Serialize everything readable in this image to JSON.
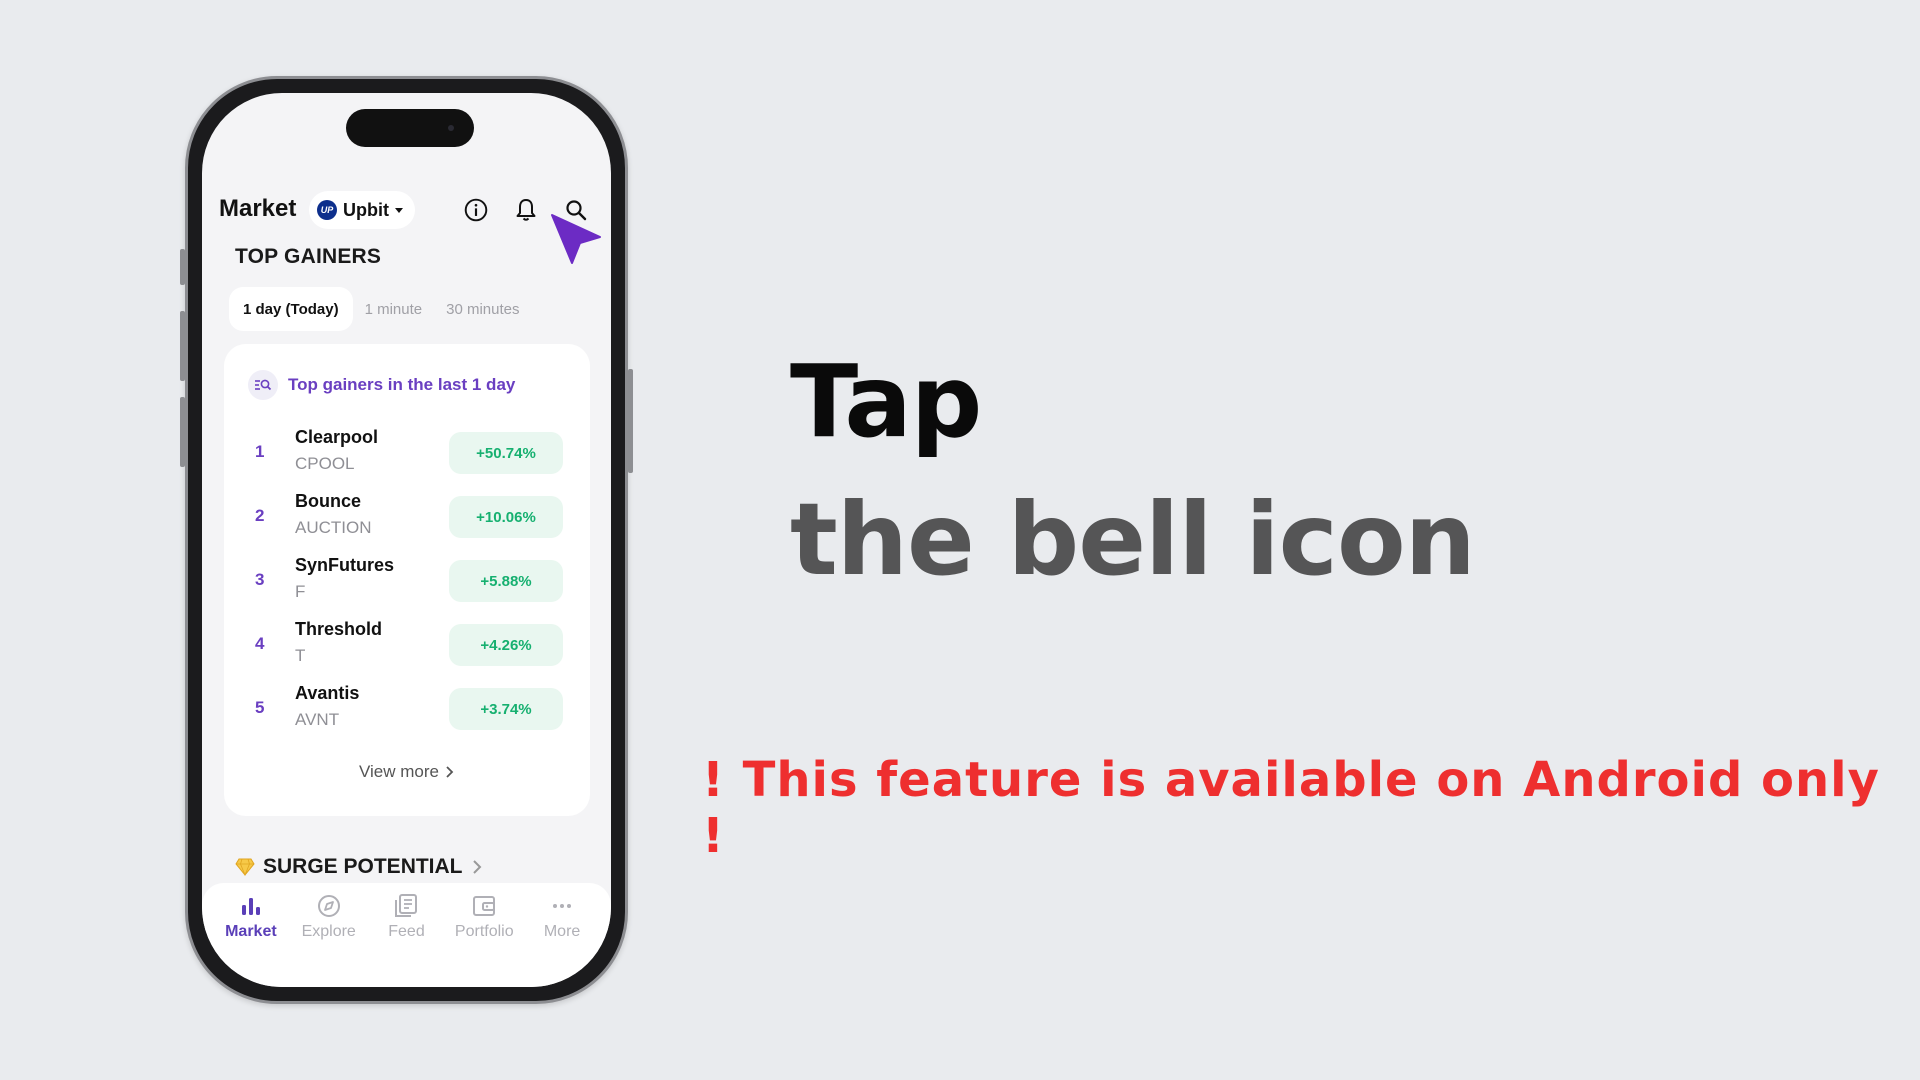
{
  "header": {
    "title": "Market",
    "exchange": {
      "name": "Upbit",
      "logo_text": "UP"
    }
  },
  "section": {
    "title": "TOP GAINERS",
    "tabs": [
      "1 day (Today)",
      "1 minute",
      "30 minutes"
    ],
    "active_tab": "1 day (Today)"
  },
  "card": {
    "heading": "Top gainers in the last 1 day",
    "rows": [
      {
        "rank": "1",
        "name": "Clearpool",
        "symbol": "CPOOL",
        "change": "+50.74%"
      },
      {
        "rank": "2",
        "name": "Bounce",
        "symbol": "AUCTION",
        "change": "+10.06%"
      },
      {
        "rank": "3",
        "name": "SynFutures",
        "symbol": "F",
        "change": "+5.88%"
      },
      {
        "rank": "4",
        "name": "Threshold",
        "symbol": "T",
        "change": "+4.26%"
      },
      {
        "rank": "5",
        "name": "Avantis",
        "symbol": "AVNT",
        "change": "+3.74%"
      }
    ],
    "view_more": "View more"
  },
  "surge": {
    "title": "SURGE POTENTIAL"
  },
  "nav": {
    "items": [
      {
        "label": "Market",
        "icon": "bar-chart-icon"
      },
      {
        "label": "Explore",
        "icon": "compass-icon"
      },
      {
        "label": "Feed",
        "icon": "feed-icon"
      },
      {
        "label": "Portfolio",
        "icon": "wallet-icon"
      },
      {
        "label": "More",
        "icon": "more-dots-icon"
      }
    ],
    "active": "Market"
  },
  "instruction": {
    "line1": "Tap",
    "line2": "the bell icon",
    "notice": "! This feature is available on Android only !"
  },
  "colors": {
    "accent": "#6a3fc1",
    "positive": "#16b070",
    "notice": "#ee2f2f",
    "cursor": "#6c2bc4"
  }
}
